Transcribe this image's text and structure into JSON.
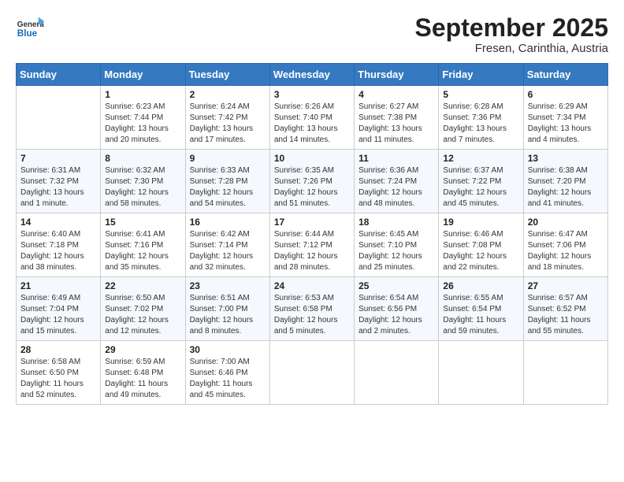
{
  "header": {
    "logo_general": "General",
    "logo_blue": "Blue",
    "month_title": "September 2025",
    "location": "Fresen, Carinthia, Austria"
  },
  "weekdays": [
    "Sunday",
    "Monday",
    "Tuesday",
    "Wednesday",
    "Thursday",
    "Friday",
    "Saturday"
  ],
  "weeks": [
    [
      {
        "day": null
      },
      {
        "day": "1",
        "sunrise": "Sunrise: 6:23 AM",
        "sunset": "Sunset: 7:44 PM",
        "daylight": "Daylight: 13 hours and 20 minutes."
      },
      {
        "day": "2",
        "sunrise": "Sunrise: 6:24 AM",
        "sunset": "Sunset: 7:42 PM",
        "daylight": "Daylight: 13 hours and 17 minutes."
      },
      {
        "day": "3",
        "sunrise": "Sunrise: 6:26 AM",
        "sunset": "Sunset: 7:40 PM",
        "daylight": "Daylight: 13 hours and 14 minutes."
      },
      {
        "day": "4",
        "sunrise": "Sunrise: 6:27 AM",
        "sunset": "Sunset: 7:38 PM",
        "daylight": "Daylight: 13 hours and 11 minutes."
      },
      {
        "day": "5",
        "sunrise": "Sunrise: 6:28 AM",
        "sunset": "Sunset: 7:36 PM",
        "daylight": "Daylight: 13 hours and 7 minutes."
      },
      {
        "day": "6",
        "sunrise": "Sunrise: 6:29 AM",
        "sunset": "Sunset: 7:34 PM",
        "daylight": "Daylight: 13 hours and 4 minutes."
      }
    ],
    [
      {
        "day": "7",
        "sunrise": "Sunrise: 6:31 AM",
        "sunset": "Sunset: 7:32 PM",
        "daylight": "Daylight: 13 hours and 1 minute."
      },
      {
        "day": "8",
        "sunrise": "Sunrise: 6:32 AM",
        "sunset": "Sunset: 7:30 PM",
        "daylight": "Daylight: 12 hours and 58 minutes."
      },
      {
        "day": "9",
        "sunrise": "Sunrise: 6:33 AM",
        "sunset": "Sunset: 7:28 PM",
        "daylight": "Daylight: 12 hours and 54 minutes."
      },
      {
        "day": "10",
        "sunrise": "Sunrise: 6:35 AM",
        "sunset": "Sunset: 7:26 PM",
        "daylight": "Daylight: 12 hours and 51 minutes."
      },
      {
        "day": "11",
        "sunrise": "Sunrise: 6:36 AM",
        "sunset": "Sunset: 7:24 PM",
        "daylight": "Daylight: 12 hours and 48 minutes."
      },
      {
        "day": "12",
        "sunrise": "Sunrise: 6:37 AM",
        "sunset": "Sunset: 7:22 PM",
        "daylight": "Daylight: 12 hours and 45 minutes."
      },
      {
        "day": "13",
        "sunrise": "Sunrise: 6:38 AM",
        "sunset": "Sunset: 7:20 PM",
        "daylight": "Daylight: 12 hours and 41 minutes."
      }
    ],
    [
      {
        "day": "14",
        "sunrise": "Sunrise: 6:40 AM",
        "sunset": "Sunset: 7:18 PM",
        "daylight": "Daylight: 12 hours and 38 minutes."
      },
      {
        "day": "15",
        "sunrise": "Sunrise: 6:41 AM",
        "sunset": "Sunset: 7:16 PM",
        "daylight": "Daylight: 12 hours and 35 minutes."
      },
      {
        "day": "16",
        "sunrise": "Sunrise: 6:42 AM",
        "sunset": "Sunset: 7:14 PM",
        "daylight": "Daylight: 12 hours and 32 minutes."
      },
      {
        "day": "17",
        "sunrise": "Sunrise: 6:44 AM",
        "sunset": "Sunset: 7:12 PM",
        "daylight": "Daylight: 12 hours and 28 minutes."
      },
      {
        "day": "18",
        "sunrise": "Sunrise: 6:45 AM",
        "sunset": "Sunset: 7:10 PM",
        "daylight": "Daylight: 12 hours and 25 minutes."
      },
      {
        "day": "19",
        "sunrise": "Sunrise: 6:46 AM",
        "sunset": "Sunset: 7:08 PM",
        "daylight": "Daylight: 12 hours and 22 minutes."
      },
      {
        "day": "20",
        "sunrise": "Sunrise: 6:47 AM",
        "sunset": "Sunset: 7:06 PM",
        "daylight": "Daylight: 12 hours and 18 minutes."
      }
    ],
    [
      {
        "day": "21",
        "sunrise": "Sunrise: 6:49 AM",
        "sunset": "Sunset: 7:04 PM",
        "daylight": "Daylight: 12 hours and 15 minutes."
      },
      {
        "day": "22",
        "sunrise": "Sunrise: 6:50 AM",
        "sunset": "Sunset: 7:02 PM",
        "daylight": "Daylight: 12 hours and 12 minutes."
      },
      {
        "day": "23",
        "sunrise": "Sunrise: 6:51 AM",
        "sunset": "Sunset: 7:00 PM",
        "daylight": "Daylight: 12 hours and 8 minutes."
      },
      {
        "day": "24",
        "sunrise": "Sunrise: 6:53 AM",
        "sunset": "Sunset: 6:58 PM",
        "daylight": "Daylight: 12 hours and 5 minutes."
      },
      {
        "day": "25",
        "sunrise": "Sunrise: 6:54 AM",
        "sunset": "Sunset: 6:56 PM",
        "daylight": "Daylight: 12 hours and 2 minutes."
      },
      {
        "day": "26",
        "sunrise": "Sunrise: 6:55 AM",
        "sunset": "Sunset: 6:54 PM",
        "daylight": "Daylight: 11 hours and 59 minutes."
      },
      {
        "day": "27",
        "sunrise": "Sunrise: 6:57 AM",
        "sunset": "Sunset: 6:52 PM",
        "daylight": "Daylight: 11 hours and 55 minutes."
      }
    ],
    [
      {
        "day": "28",
        "sunrise": "Sunrise: 6:58 AM",
        "sunset": "Sunset: 6:50 PM",
        "daylight": "Daylight: 11 hours and 52 minutes."
      },
      {
        "day": "29",
        "sunrise": "Sunrise: 6:59 AM",
        "sunset": "Sunset: 6:48 PM",
        "daylight": "Daylight: 11 hours and 49 minutes."
      },
      {
        "day": "30",
        "sunrise": "Sunrise: 7:00 AM",
        "sunset": "Sunset: 6:46 PM",
        "daylight": "Daylight: 11 hours and 45 minutes."
      },
      {
        "day": null
      },
      {
        "day": null
      },
      {
        "day": null
      },
      {
        "day": null
      }
    ]
  ]
}
